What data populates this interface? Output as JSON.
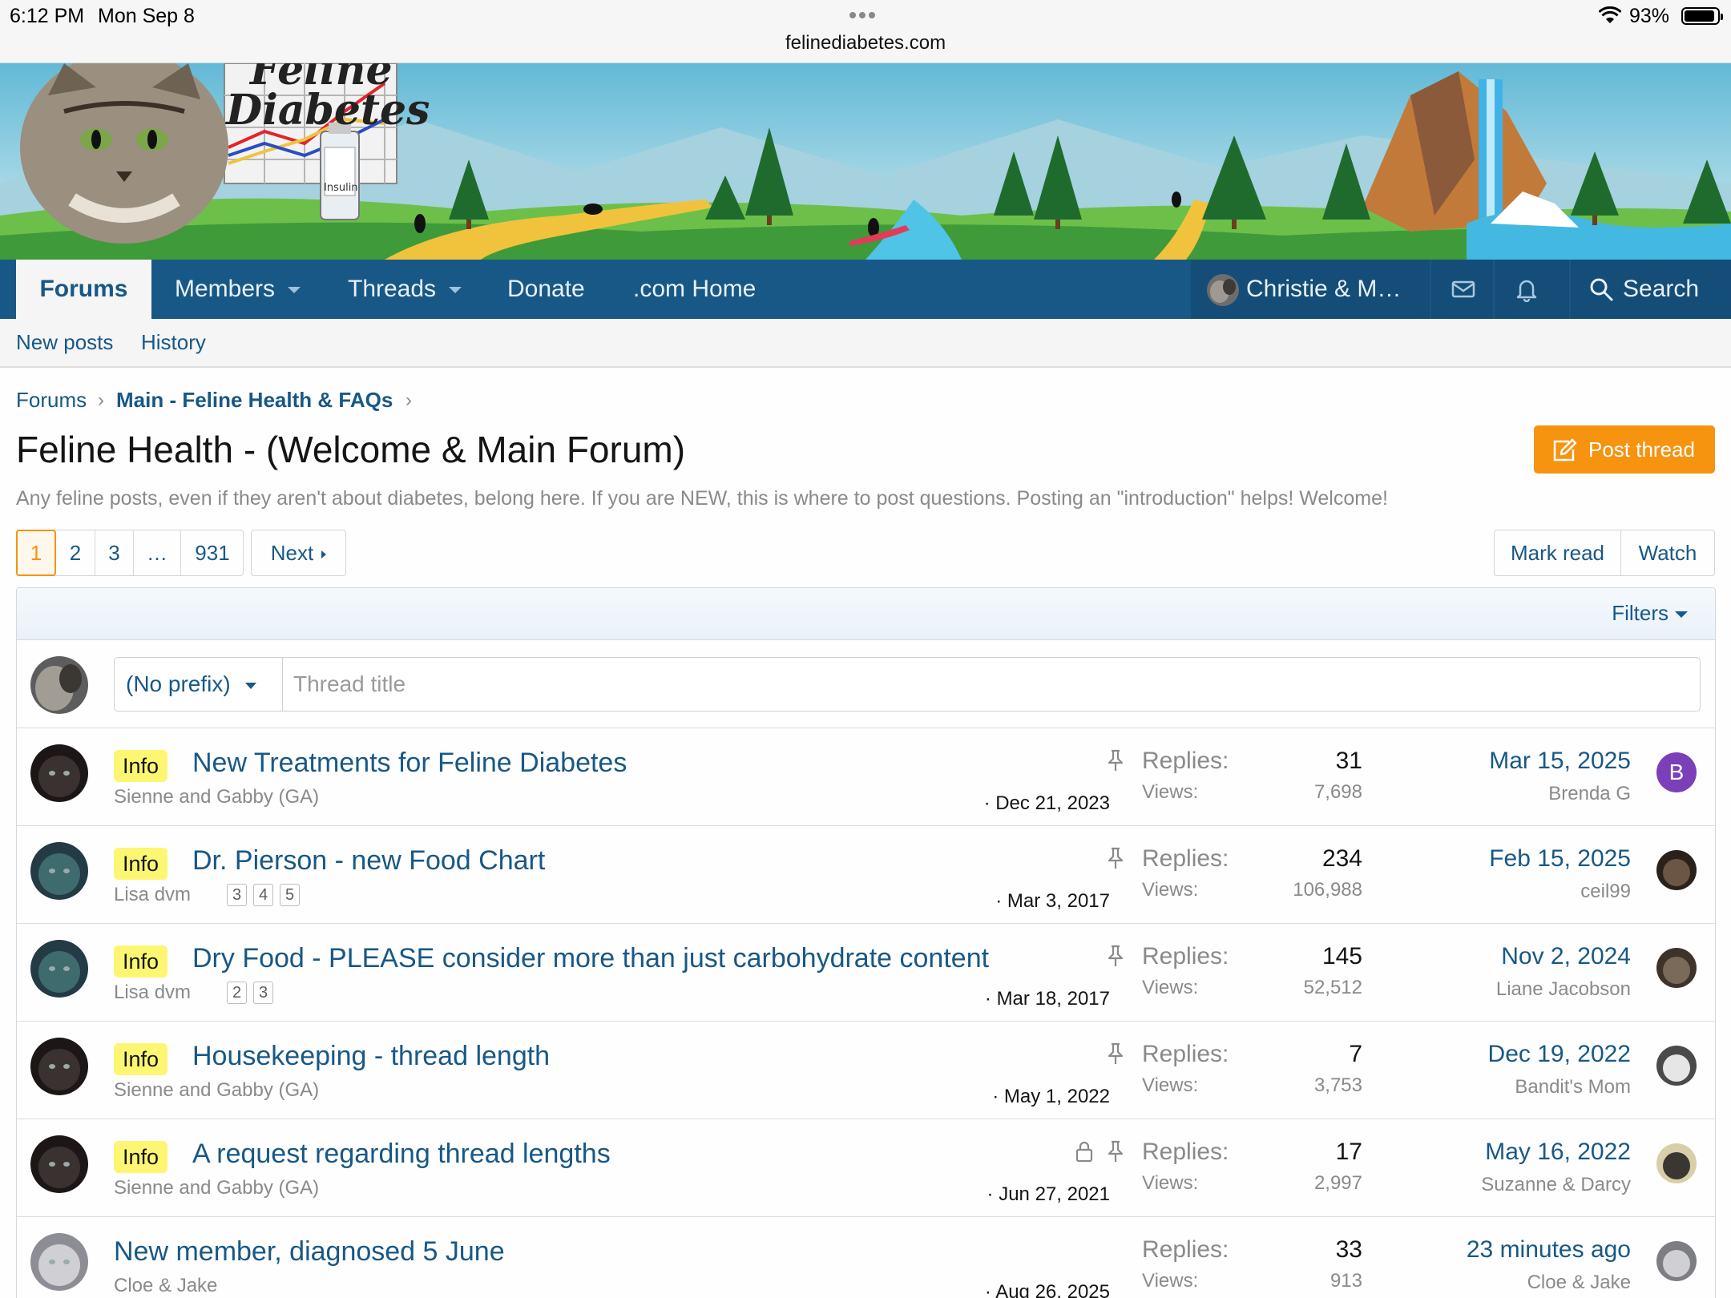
{
  "status_bar": {
    "time": "6:12 PM",
    "day": "Mon Sep 8",
    "battery": "93%",
    "battery_level": 0.93
  },
  "browser": {
    "url": "felinediabetes.com"
  },
  "logo": {
    "line1": "Feline",
    "line2": "Diabetes",
    "vial_label": "Insulin"
  },
  "nav": {
    "tabs": [
      {
        "label": "Forums"
      },
      {
        "label": "Members"
      },
      {
        "label": "Threads"
      },
      {
        "label": "Donate"
      },
      {
        "label": ".com Home"
      }
    ],
    "user": "Christie & M…",
    "search": "Search"
  },
  "subnav": {
    "new_posts": "New posts",
    "history": "History"
  },
  "breadcrumb": {
    "forums": "Forums",
    "main": "Main - Feline Health & FAQs",
    "sep": "›"
  },
  "page": {
    "title": "Feline Health - (Welcome & Main Forum)",
    "post_thread": "Post thread",
    "description": "Any feline posts, even if they aren't about diabetes, belong here. If you are NEW, this is where to post questions. Posting an \"introduction\" helps! Welcome!"
  },
  "pagination": {
    "pages": [
      "1",
      "2",
      "3",
      "…",
      "931"
    ],
    "next": "Next"
  },
  "actions": {
    "mark_read": "Mark read",
    "watch": "Watch"
  },
  "filters": {
    "label": "Filters"
  },
  "quick_thread": {
    "prefix": "(No prefix)",
    "placeholder": "Thread title"
  },
  "labels": {
    "replies": "Replies:",
    "views": "Views:"
  },
  "threads": [
    {
      "prefix": "Info",
      "title": "New Treatments for Feline Diabetes",
      "author": "Sienne and Gabby (GA)",
      "pages": [],
      "start": "· Dec 21, 2023",
      "replies": "31",
      "views": "7,698",
      "last_date": "Mar 15, 2025",
      "last_user": "Brenda G",
      "last_letter": "B",
      "locked": false,
      "pinned": true
    },
    {
      "prefix": "Info",
      "title": "Dr. Pierson - new Food Chart",
      "author": "Lisa dvm",
      "pages": [
        "3",
        "4",
        "5"
      ],
      "start": "· Mar 3, 2017",
      "replies": "234",
      "views": "106,988",
      "last_date": "Feb 15, 2025",
      "last_user": "ceil99",
      "last_letter": "",
      "locked": false,
      "pinned": true
    },
    {
      "prefix": "Info",
      "title": "Dry Food - PLEASE consider more than just carbohydrate content",
      "author": "Lisa dvm",
      "pages": [
        "2",
        "3"
      ],
      "start": "· Mar 18, 2017",
      "replies": "145",
      "views": "52,512",
      "last_date": "Nov 2, 2024",
      "last_user": "Liane Jacobson",
      "last_letter": "",
      "locked": false,
      "pinned": true
    },
    {
      "prefix": "Info",
      "title": "Housekeeping - thread length",
      "author": "Sienne and Gabby (GA)",
      "pages": [],
      "start": "· May 1, 2022",
      "replies": "7",
      "views": "3,753",
      "last_date": "Dec 19, 2022",
      "last_user": "Bandit's Mom",
      "last_letter": "",
      "locked": false,
      "pinned": true
    },
    {
      "prefix": "Info",
      "title": "A request regarding thread lengths",
      "author": "Sienne and Gabby (GA)",
      "pages": [],
      "start": "· Jun 27, 2021",
      "replies": "17",
      "views": "2,997",
      "last_date": "May 16, 2022",
      "last_user": "Suzanne & Darcy",
      "last_letter": "",
      "locked": true,
      "pinned": true
    },
    {
      "prefix": "",
      "title": "New member, diagnosed 5 June",
      "author": "Cloe & Jake",
      "pages": [],
      "start": "· Aug 26, 2025",
      "replies": "33",
      "views": "913",
      "last_date": "23 minutes ago",
      "last_user": "Cloe & Jake",
      "last_letter": "",
      "locked": false,
      "pinned": false
    }
  ],
  "colors": {
    "brand_blue": "#185886",
    "accent_orange": "#f6930f",
    "prefix_yellow": "#fdf672"
  }
}
